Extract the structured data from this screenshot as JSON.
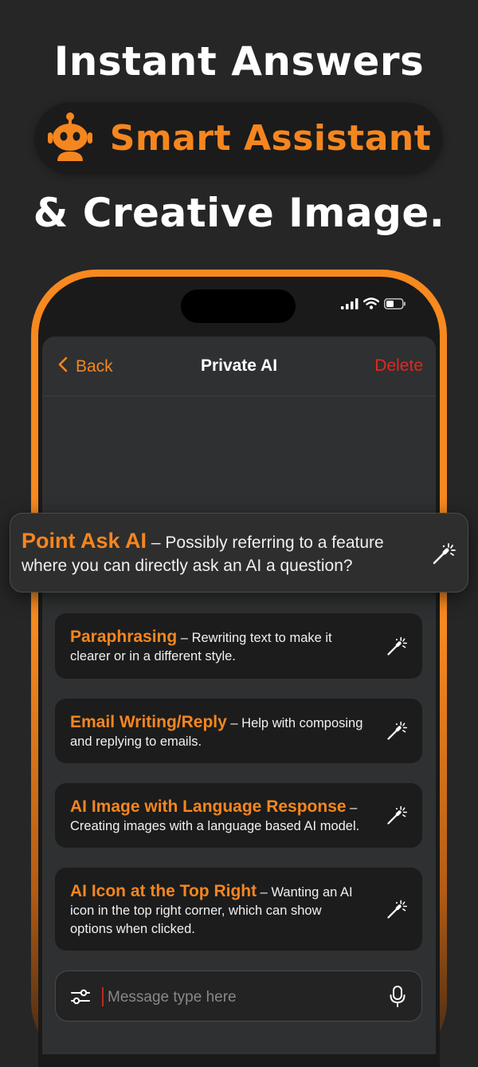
{
  "headline": {
    "line1": "Instant Answers",
    "pill": "Smart Assistant",
    "line3": "& Creative Image."
  },
  "navbar": {
    "back_label": "Back",
    "title": "Private AI",
    "delete_label": "Delete"
  },
  "featured": {
    "title": "Point Ask AI",
    "description": " – Possibly referring to a feature where you can directly ask an AI a question?"
  },
  "cards": [
    {
      "title": "Paraphrasing",
      "description": " – Rewriting text to make it clearer or in a different style."
    },
    {
      "title": "Email Writing/Reply",
      "description": " – Help with composing and replying to emails."
    },
    {
      "title": "AI Image with Language Response",
      "description": " – Creating images with a language based AI model."
    },
    {
      "title": "AI Icon at the Top Right",
      "description": " – Wanting an AI icon in the top right corner, which can show options when clicked."
    }
  ],
  "input": {
    "placeholder": "Message type here"
  },
  "colors": {
    "accent": "#f5861f",
    "delete": "#e0291f",
    "background": "#262626"
  },
  "icons": {
    "robot": "robot-icon",
    "wand": "magic-wand-icon",
    "filter": "sliders-icon",
    "mic": "microphone-icon"
  }
}
